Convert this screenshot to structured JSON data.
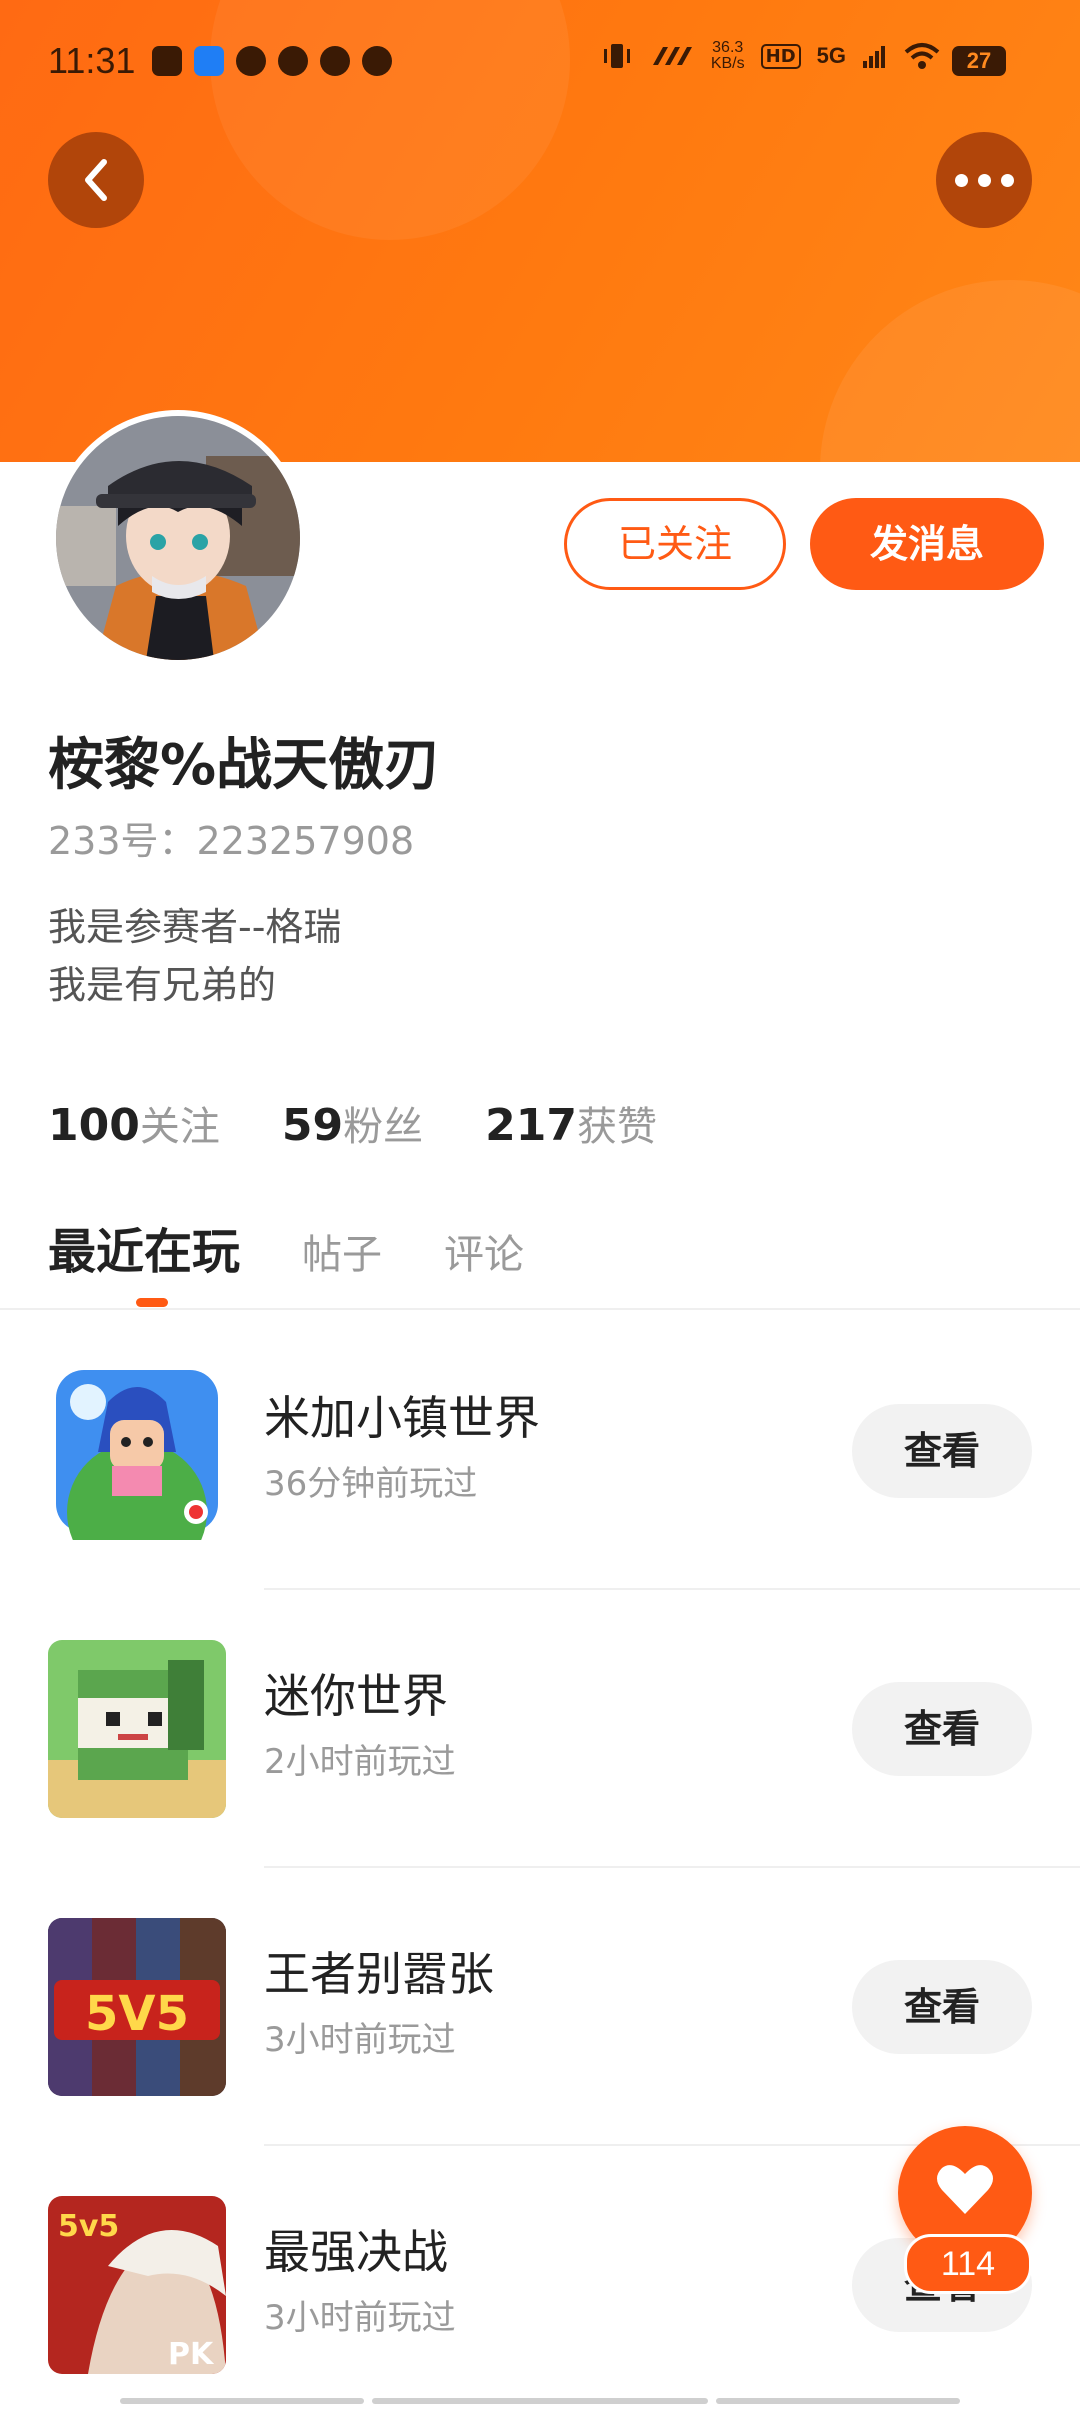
{
  "status_bar": {
    "time": "11:31",
    "network_speed_value": "36.3",
    "network_speed_unit": "KB/s",
    "hd_label": "HD",
    "signal_label": "5G",
    "battery": "27"
  },
  "profile": {
    "name": "桉黎%战天傲刃",
    "id_text": "233号：223257908",
    "bio_line_1": "我是参赛者--格瑞",
    "bio_line_2": "我是有兄弟的",
    "follow_button": "已关注",
    "message_button": "发消息"
  },
  "stats": [
    {
      "value": "100",
      "label": "关注"
    },
    {
      "value": "59",
      "label": "粉丝"
    },
    {
      "value": "217",
      "label": "获赞"
    }
  ],
  "tabs": [
    {
      "label": "最近在玩",
      "active": true
    },
    {
      "label": "帖子",
      "active": false
    },
    {
      "label": "评论",
      "active": false
    }
  ],
  "games": [
    {
      "name": "米加小镇世界",
      "time": "36分钟前玩过",
      "button": "查看"
    },
    {
      "name": "迷你世界",
      "time": "2小时前玩过",
      "button": "查看"
    },
    {
      "name": "王者别嚣张",
      "time": "3小时前玩过",
      "button": "查看"
    },
    {
      "name": "最强决战",
      "time": "3小时前玩过",
      "button": "查看"
    }
  ],
  "like_fab": {
    "count": "114",
    "icon": "heart-icon"
  },
  "colors": {
    "accent": "#ff5a14",
    "header": "#ff7a10"
  }
}
